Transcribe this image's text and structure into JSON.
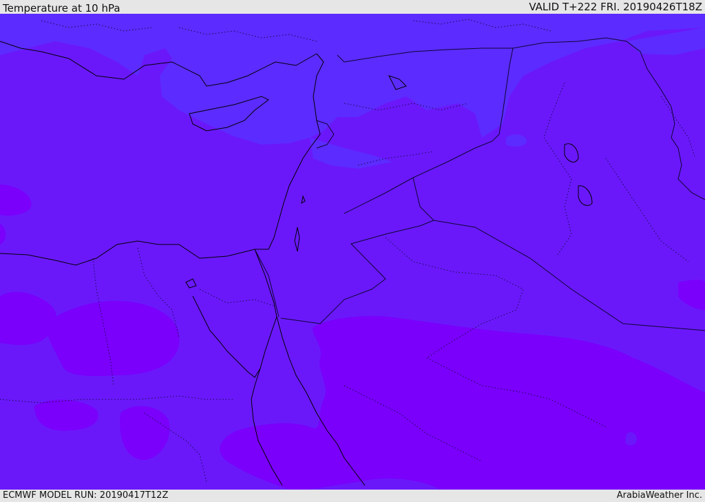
{
  "header": {
    "title": "Temperature at 10 hPa",
    "valid": "VALID T+222 FRI. 20190426T18Z"
  },
  "footer": {
    "model_run": "ECMWF MODEL RUN: 20190417T12Z",
    "credit": "ArabiaWeather Inc."
  },
  "colors": {
    "base_fill": "#6a18fa",
    "cool_band": "#5c2bff",
    "warm_band": "#7a00fb",
    "coast_line": "#000000",
    "border_line": "#1a0a4a"
  }
}
